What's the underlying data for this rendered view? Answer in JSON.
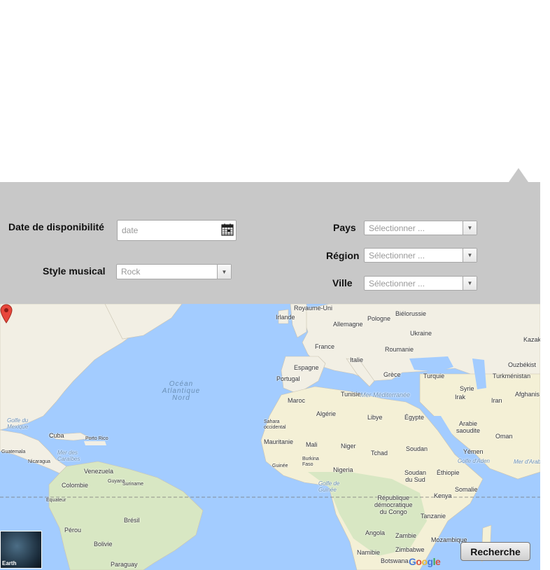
{
  "form": {
    "date_label": "Date de disponibilité",
    "date_placeholder": "date",
    "style_label": "Style musical",
    "style_value": "Rock",
    "pays_label": "Pays",
    "pays_value": "Sélectionner ...",
    "region_label": "Région",
    "region_value": "Sélectionner ...",
    "ville_label": "Ville",
    "ville_value": "Sélectionner ..."
  },
  "map": {
    "ocean_label": "Océan\nAtlantique\nNord",
    "labels": [
      {
        "name": "royaume-uni",
        "text": "Royaume-Uni"
      },
      {
        "name": "irlande",
        "text": "Irlande"
      },
      {
        "name": "pologne",
        "text": "Pologne"
      },
      {
        "name": "bielorussie",
        "text": "Biélorussie"
      },
      {
        "name": "allemagne",
        "text": "Allemagne"
      },
      {
        "name": "ukraine",
        "text": "Ukraine"
      },
      {
        "name": "france",
        "text": "France"
      },
      {
        "name": "roumanie",
        "text": "Roumanie"
      },
      {
        "name": "italie",
        "text": "Italie"
      },
      {
        "name": "espagne",
        "text": "Espagne"
      },
      {
        "name": "portugal",
        "text": "Portugal"
      },
      {
        "name": "grece",
        "text": "Grèce"
      },
      {
        "name": "turquie",
        "text": "Turquie"
      },
      {
        "name": "kazakhstan",
        "text": "Kazak"
      },
      {
        "name": "ouzbekistan",
        "text": "Ouzbékist"
      },
      {
        "name": "turkmenistan",
        "text": "Turkménistan"
      },
      {
        "name": "syrie",
        "text": "Syrie"
      },
      {
        "name": "irak",
        "text": "Irak"
      },
      {
        "name": "iran",
        "text": "Iran"
      },
      {
        "name": "afghanistan",
        "text": "Afghanis"
      },
      {
        "name": "tunisie",
        "text": "Tunisie"
      },
      {
        "name": "maroc",
        "text": "Maroc"
      },
      {
        "name": "mer-mediterranee",
        "text": "Mer Méditerranée"
      },
      {
        "name": "algerie",
        "text": "Algérie"
      },
      {
        "name": "libye",
        "text": "Libye"
      },
      {
        "name": "egypte",
        "text": "Égypte"
      },
      {
        "name": "arabie-saoudite",
        "text": "Arabie\nsaoudite"
      },
      {
        "name": "oman",
        "text": "Oman"
      },
      {
        "name": "sahara-occidental",
        "text": "Sahara\noccidental"
      },
      {
        "name": "mauritanie",
        "text": "Mauritanie"
      },
      {
        "name": "mali",
        "text": "Mali"
      },
      {
        "name": "niger",
        "text": "Niger"
      },
      {
        "name": "tchad",
        "text": "Tchad"
      },
      {
        "name": "soudan",
        "text": "Soudan"
      },
      {
        "name": "yemen",
        "text": "Yémen"
      },
      {
        "name": "golfe-aden",
        "text": "Golfe d'Aden"
      },
      {
        "name": "mer-arabie",
        "text": "Mer d'Arab"
      },
      {
        "name": "guinee",
        "text": "Guinée"
      },
      {
        "name": "burkina-faso",
        "text": "Burkina\nFaso"
      },
      {
        "name": "nigeria",
        "text": "Nigeria"
      },
      {
        "name": "soudan-du-sud",
        "text": "Soudan\ndu Sud"
      },
      {
        "name": "ethiopie",
        "text": "Éthiopie"
      },
      {
        "name": "somalie",
        "text": "Somalie"
      },
      {
        "name": "golfe-guinee",
        "text": "Golfe de\nGuinée"
      },
      {
        "name": "kenya",
        "text": "Kenya"
      },
      {
        "name": "rdc",
        "text": "République\ndémocratique\ndu Congo"
      },
      {
        "name": "tanzanie",
        "text": "Tanzanie"
      },
      {
        "name": "angola",
        "text": "Angola"
      },
      {
        "name": "zambie",
        "text": "Zambie"
      },
      {
        "name": "mozambique",
        "text": "Mozambique"
      },
      {
        "name": "namibie",
        "text": "Namibie"
      },
      {
        "name": "zimbabwe",
        "text": "Zimbabwe"
      },
      {
        "name": "botswana",
        "text": "Botswana"
      },
      {
        "name": "golfe-mexique",
        "text": "Golfe du\nMexique"
      },
      {
        "name": "cuba",
        "text": "Cuba"
      },
      {
        "name": "porto-rico",
        "text": "Porto Rico"
      },
      {
        "name": "guatemala",
        "text": "Guatemala"
      },
      {
        "name": "nicaragua",
        "text": "Nicaragua"
      },
      {
        "name": "mer-caraibes",
        "text": "Mer des\nCaraïbes"
      },
      {
        "name": "venezuela",
        "text": "Venezuela"
      },
      {
        "name": "colombie",
        "text": "Colombie"
      },
      {
        "name": "guyana",
        "text": "Guyana"
      },
      {
        "name": "suriname",
        "text": "Suriname"
      },
      {
        "name": "equateur",
        "text": "Équateur"
      },
      {
        "name": "perou",
        "text": "Pérou"
      },
      {
        "name": "bresil",
        "text": "Brésil"
      },
      {
        "name": "bolivie",
        "text": "Bolivie"
      },
      {
        "name": "paraguay",
        "text": "Paraguay"
      }
    ],
    "earth_label": "Earth",
    "google_logo": [
      "G",
      "o",
      "o",
      "g",
      "l",
      "e"
    ]
  },
  "actions": {
    "search_label": "Recherche"
  }
}
